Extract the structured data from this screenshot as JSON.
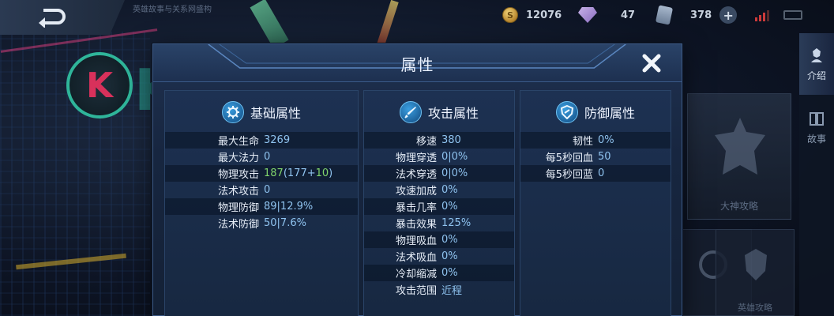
{
  "topbar": {
    "subtitle": "英雄故事与关系网盛构",
    "gold": "12076",
    "gems": "47",
    "tickets": "378"
  },
  "sidebar": {
    "tabs": [
      {
        "label": "介绍",
        "icon": "hero-icon",
        "active": true
      },
      {
        "label": "故事",
        "icon": "book-icon",
        "active": false
      }
    ],
    "guide_label": "大神攻略",
    "card_labels": [
      "",
      "英雄攻略"
    ]
  },
  "modal": {
    "title": "属性",
    "panels": [
      {
        "title": "基础属性",
        "icon": "gear-icon",
        "rows": [
          {
            "label": "最大生命",
            "value": "3269"
          },
          {
            "label": "最大法力",
            "value": "0"
          },
          {
            "label": "物理攻击",
            "value": "187",
            "bonus_open": "(177+",
            "bonus": "10",
            "bonus_close": ")"
          },
          {
            "label": "法术攻击",
            "value": "0"
          },
          {
            "label": "物理防御",
            "value": "89|12.9%"
          },
          {
            "label": "法术防御",
            "value": "50|7.6%"
          }
        ]
      },
      {
        "title": "攻击属性",
        "icon": "sword-icon",
        "rows": [
          {
            "label": "移速",
            "value": "380"
          },
          {
            "label": "物理穿透",
            "value": "0|0%"
          },
          {
            "label": "法术穿透",
            "value": "0|0%"
          },
          {
            "label": "攻速加成",
            "value": "0%"
          },
          {
            "label": "暴击几率",
            "value": "0%"
          },
          {
            "label": "暴击效果",
            "value": "125%"
          },
          {
            "label": "物理吸血",
            "value": "0%"
          },
          {
            "label": "法术吸血",
            "value": "0%"
          },
          {
            "label": "冷却缩减",
            "value": "0%"
          },
          {
            "label": "攻击范围",
            "value": "近程"
          }
        ]
      },
      {
        "title": "防御属性",
        "icon": "shield-icon",
        "rows": [
          {
            "label": "韧性",
            "value": "0%"
          },
          {
            "label": "每5秒回血",
            "value": "50"
          },
          {
            "label": "每5秒回蓝",
            "value": "0"
          }
        ]
      }
    ]
  },
  "colors": {
    "value_blue": "#8fc3ef",
    "bonus_green": "#7fd36b",
    "panel_bg": "#1d3152"
  }
}
